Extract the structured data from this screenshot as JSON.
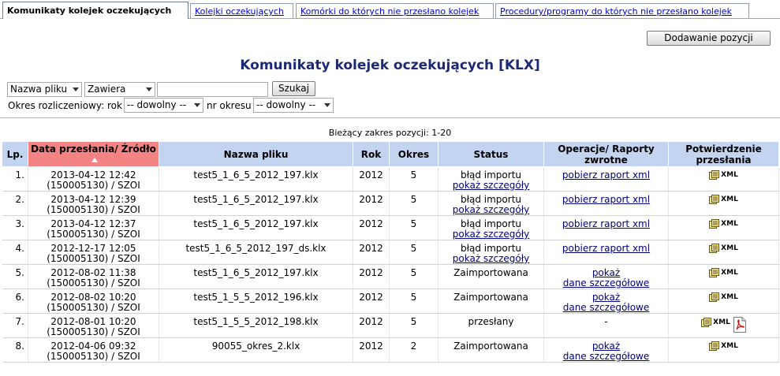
{
  "tabs": [
    {
      "label": "Komunikaty kolejek oczekujących",
      "active": true
    },
    {
      "label": "Kolejki oczekujących",
      "active": false
    },
    {
      "label": "Komórki do których nie przesłano kolejek",
      "active": false
    },
    {
      "label": "Procedury/programy do których nie przesłano kolejek",
      "active": false
    }
  ],
  "add_button": "Dodawanie pozycji",
  "page_title": "Komunikaty kolejek oczekujących [KLX]",
  "search": {
    "field_select": "Nazwa pliku",
    "mode_select": "Zawiera",
    "query": "",
    "button": "Szukaj"
  },
  "period": {
    "label_year": "Okres rozliczeniowy: rok",
    "year_select": "-- dowolny --",
    "label_period": "nr okresu",
    "period_select": "-- dowolny --"
  },
  "range_text": "Bieżący zakres pozycji: 1-20",
  "columns": {
    "lp": "Lp.",
    "date": "Data przesłania/ Źródło",
    "file": "Nazwa pliku",
    "year": "Rok",
    "period": "Okres",
    "status": "Status",
    "ops": "Operacje/ Raporty zwrotne",
    "confirm": "Potwierdzenie przesłania"
  },
  "rows": [
    {
      "lp": "1.",
      "date": "2013-04-12 12:42",
      "source": "(150005130) / SZOI",
      "file": "test5_1_6_5_2012_197.klx",
      "year": "2012",
      "period": "5",
      "status": "błąd importu",
      "status_link": "pokaż szczegóły",
      "op1": "pobierz raport xml",
      "op2": "",
      "xml": "XML",
      "pdf": false
    },
    {
      "lp": "2.",
      "date": "2013-04-12 12:39",
      "source": "(150005130) / SZOI",
      "file": "test5_1_6_5_2012_197.klx",
      "year": "2012",
      "period": "5",
      "status": "błąd importu",
      "status_link": "pokaż szczegóły",
      "op1": "pobierz raport xml",
      "op2": "",
      "xml": "XML",
      "pdf": false
    },
    {
      "lp": "3.",
      "date": "2013-04-12 12:37",
      "source": "(150005130) / SZOI",
      "file": "test5_1_6_5_2012_197.klx",
      "year": "2012",
      "period": "5",
      "status": "błąd importu",
      "status_link": "pokaż szczegóły",
      "op1": "pobierz raport xml",
      "op2": "",
      "xml": "XML",
      "pdf": false
    },
    {
      "lp": "4.",
      "date": "2012-12-17 12:05",
      "source": "(150005130) / SZOI",
      "file": "test5_1_6_5_2012_197_ds.klx",
      "year": "2012",
      "period": "5",
      "status": "błąd importu",
      "status_link": "pokaż szczegóły",
      "op1": "pobierz raport xml",
      "op2": "",
      "xml": "XML",
      "pdf": false
    },
    {
      "lp": "5.",
      "date": "2012-08-02 11:38",
      "source": "(150005130) / SZOI",
      "file": "test5_1_6_5_2012_197.klx",
      "year": "2012",
      "period": "5",
      "status": "Zaimportowana",
      "status_link": "",
      "op1": "pokaż",
      "op2": "dane szczegółowe",
      "xml": "XML",
      "pdf": false
    },
    {
      "lp": "6.",
      "date": "2012-08-02 10:20",
      "source": "(150005130) / SZOI",
      "file": "test5_1_5_5_2012_196.klx",
      "year": "2012",
      "period": "5",
      "status": "Zaimportowana",
      "status_link": "",
      "op1": "pokaż",
      "op2": "dane szczegółowe",
      "xml": "XML",
      "pdf": false
    },
    {
      "lp": "7.",
      "date": "2012-08-01 10:20",
      "source": "(150005130) / SZOI",
      "file": "test5_1_5_5_2012_198.klx",
      "year": "2012",
      "period": "5",
      "status": "przesłany",
      "status_link": "",
      "op1": "",
      "op2": "",
      "op_plain": "-",
      "xml": "XML",
      "pdf": true
    },
    {
      "lp": "8.",
      "date": "2012-04-06 09:32",
      "source": "(150005130) / SZOI",
      "file": "90055_okres_2.klx",
      "year": "2012",
      "period": "2",
      "status": "Zaimportowana",
      "status_link": "",
      "op1": "pokaż",
      "op2": "dane szczegółowe",
      "xml": "XML",
      "pdf": false
    }
  ],
  "colors": {
    "header_bg": "#c2d4ef",
    "sorted_header_bg": "#f48383",
    "title": "#1b2a72",
    "link": "#000080"
  },
  "icons": {
    "xml": "xml-file-icon",
    "pdf": "pdf-file-icon",
    "sort": "sort-ascending-icon"
  }
}
